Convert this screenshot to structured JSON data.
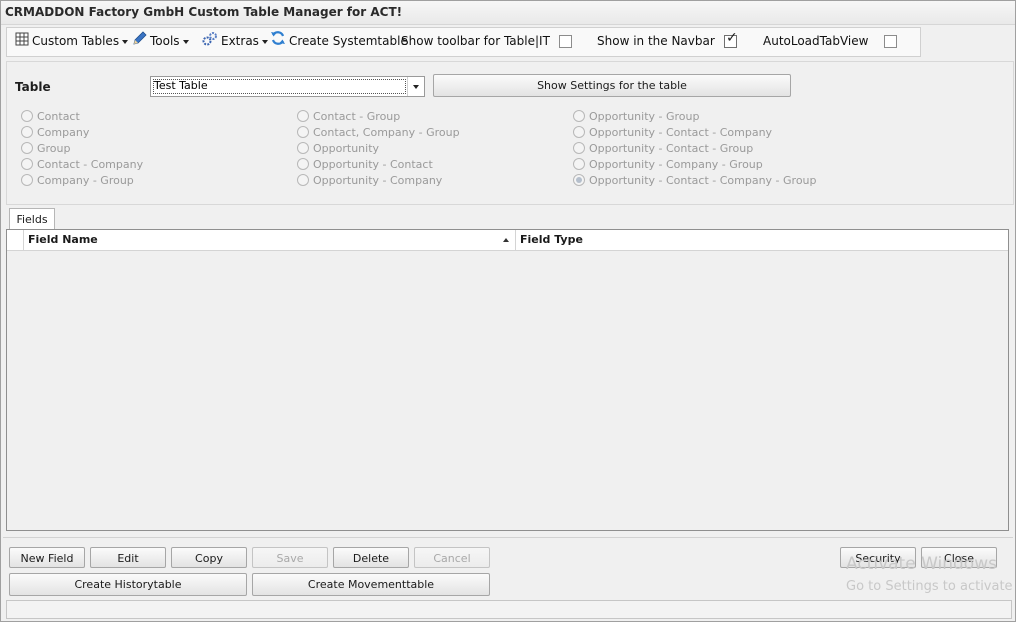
{
  "window": {
    "title": "CRMADDON Factory GmbH Custom Table Manager for ACT!"
  },
  "toolbar": {
    "custom_tables": "Custom Tables",
    "tools": "Tools",
    "extras": "Extras",
    "create_systemtable": "Create Systemtable",
    "show_toolbar_label": "Show toolbar for Table|IT",
    "show_toolbar_checked": false,
    "show_navbar_label": "Show in the Navbar",
    "show_navbar_checked": true,
    "autoload_label": "AutoLoadTabView",
    "autoload_checked": false,
    "icons": {
      "custom_tables": "table-icon",
      "tools": "pencil-icon",
      "extras": "gears-icon",
      "create_systemtable": "refresh-icon"
    }
  },
  "table_section": {
    "label": "Table",
    "selected_table": "Test Table",
    "show_settings_button": "Show Settings for the table"
  },
  "entity_options": {
    "col1": [
      "Contact",
      "Company",
      "Group",
      "Contact - Company",
      "Company - Group"
    ],
    "col2": [
      "Contact - Group",
      "Contact, Company - Group",
      "Opportunity",
      "Opportunity - Contact",
      "Opportunity - Company"
    ],
    "col3": [
      "Opportunity - Group",
      "Opportunity - Contact - Company",
      "Opportunity - Contact - Group",
      "Opportunity - Company - Group",
      "Opportunity - Contact - Company - Group"
    ],
    "selected": "Opportunity - Contact - Company - Group"
  },
  "tabs": [
    {
      "label": "Fields"
    }
  ],
  "grid": {
    "columns": [
      "Field Name",
      "Field Type"
    ],
    "sort_column": "Field Name",
    "sort_direction": "ascending",
    "rows": []
  },
  "buttons": {
    "new_field": "New Field",
    "edit": "Edit",
    "copy": "Copy",
    "save": "Save",
    "delete": "Delete",
    "cancel": "Cancel",
    "security": "Security",
    "close": "Close",
    "create_historytable": "Create Historytable",
    "create_movementtable": "Create Movementtable"
  },
  "watermark": {
    "line1": "Activate Windows",
    "line2": "Go to Settings to activate"
  }
}
